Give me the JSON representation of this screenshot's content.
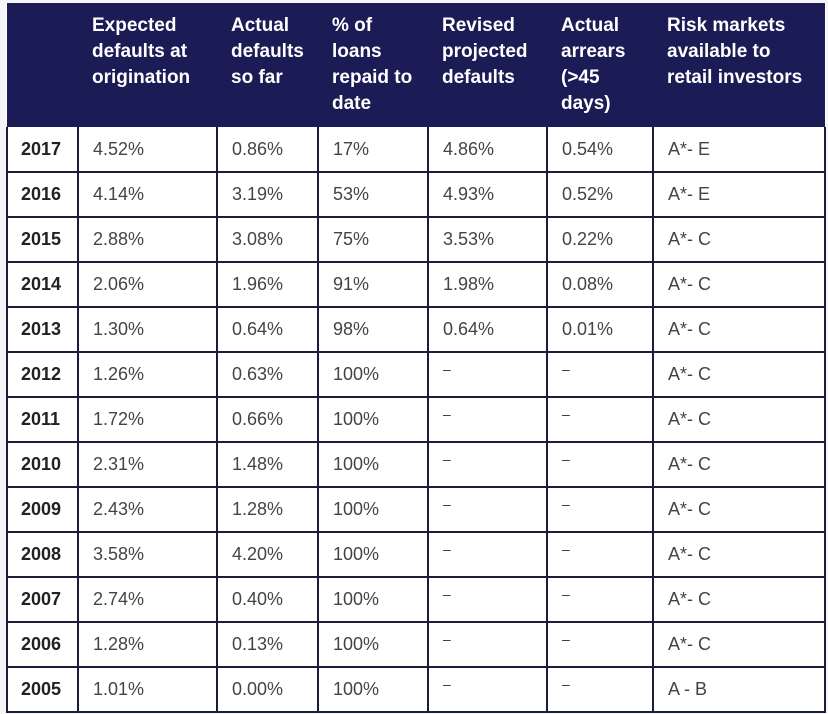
{
  "table": {
    "headers": [
      "",
      "Expected\ndefaults at\norigination",
      "Actual\ndefaults\nso far",
      "% of\nloans\nrepaid to\ndate",
      "Revised\nprojected\ndefaults",
      "Actual\narrears\n(>45\ndays)",
      "Risk markets\navailable to\nretail investors"
    ],
    "rows": [
      [
        "2017",
        "4.52%",
        "0.86%",
        "17%",
        "4.86%",
        "0.54%",
        "A*- E"
      ],
      [
        "2016",
        "4.14%",
        "3.19%",
        "53%",
        "4.93%",
        "0.52%",
        "A*- E"
      ],
      [
        "2015",
        "2.88%",
        "3.08%",
        "75%",
        "3.53%",
        "0.22%",
        "A*- C"
      ],
      [
        "2014",
        "2.06%",
        "1.96%",
        "91%",
        "1.98%",
        "0.08%",
        "A*- C"
      ],
      [
        "2013",
        "1.30%",
        "0.64%",
        "98%",
        "0.64%",
        "0.01%",
        "A*- C"
      ],
      [
        "2012",
        "1.26%",
        "0.63%",
        "100%",
        "–",
        "–",
        "A*- C"
      ],
      [
        "2011",
        "1.72%",
        "0.66%",
        "100%",
        "–",
        "–",
        "A*- C"
      ],
      [
        "2010",
        "2.31%",
        "1.48%",
        "100%",
        "–",
        "–",
        "A*- C"
      ],
      [
        "2009",
        "2.43%",
        "1.28%",
        "100%",
        "–",
        "–",
        "A*- C"
      ],
      [
        "2008",
        "3.58%",
        "4.20%",
        "100%",
        "–",
        "–",
        "A*- C"
      ],
      [
        "2007",
        "2.74%",
        "0.40%",
        "100%",
        "–",
        "–",
        "A*- C"
      ],
      [
        "2006",
        "1.28%",
        "0.13%",
        "100%",
        "–",
        "–",
        "A*- C"
      ],
      [
        "2005",
        "1.01%",
        "0.00%",
        "100%",
        "–",
        "–",
        "A - B"
      ]
    ]
  },
  "colors": {
    "header_bg": "#1b1c56",
    "header_text": "#ffffff",
    "border": "#1b1c3a"
  }
}
